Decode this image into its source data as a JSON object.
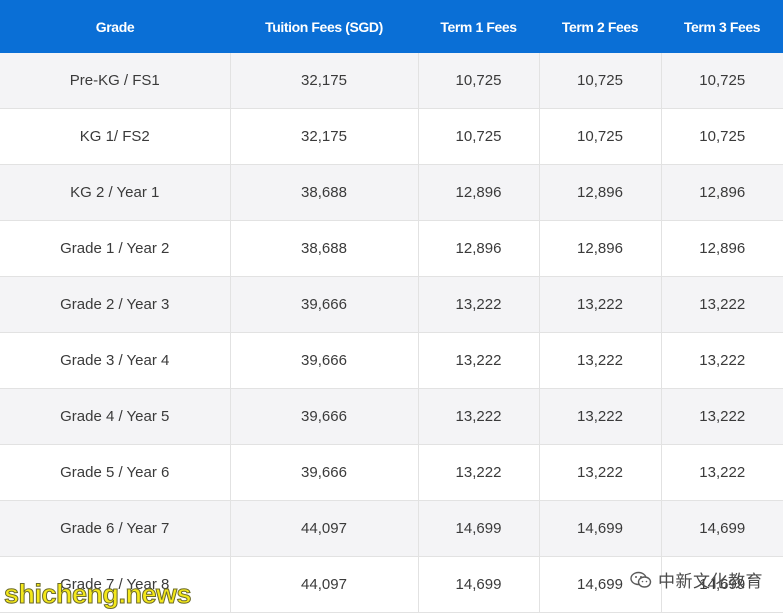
{
  "table": {
    "headers": [
      "Grade",
      "Tuition Fees (SGD)",
      "Term 1 Fees",
      "Term 2 Fees",
      "Term 3 Fees"
    ],
    "rows": [
      [
        "Pre-KG / FS1",
        "32,175",
        "10,725",
        "10,725",
        "10,725"
      ],
      [
        "KG 1/ FS2",
        "32,175",
        "10,725",
        "10,725",
        "10,725"
      ],
      [
        "KG 2 / Year 1",
        "38,688",
        "12,896",
        "12,896",
        "12,896"
      ],
      [
        "Grade 1 / Year 2",
        "38,688",
        "12,896",
        "12,896",
        "12,896"
      ],
      [
        "Grade 2 / Year 3",
        "39,666",
        "13,222",
        "13,222",
        "13,222"
      ],
      [
        "Grade 3 / Year 4",
        "39,666",
        "13,222",
        "13,222",
        "13,222"
      ],
      [
        "Grade 4 / Year 5",
        "39,666",
        "13,222",
        "13,222",
        "13,222"
      ],
      [
        "Grade 5 / Year 6",
        "39,666",
        "13,222",
        "13,222",
        "13,222"
      ],
      [
        "Grade 6 / Year 7",
        "44,097",
        "14,699",
        "14,699",
        "14,699"
      ],
      [
        "Grade 7 / Year 8",
        "44,097",
        "14,699",
        "14,699",
        "14,699"
      ]
    ]
  },
  "watermark": {
    "text": "shicheng.news"
  },
  "brand": {
    "icon": "wechat-icon",
    "text": "中新文化教育"
  },
  "colors": {
    "header_bg": "#0a6fd6",
    "header_text": "#ffffff",
    "row_odd_bg": "#f4f4f6",
    "row_even_bg": "#ffffff",
    "cell_text": "#3a3a3a",
    "watermark": "#f4e81a"
  }
}
